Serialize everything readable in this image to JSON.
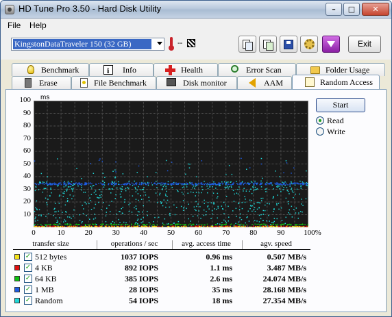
{
  "window": {
    "title": "HD Tune Pro 3.50 - Hard Disk Utility",
    "min": "–",
    "max": "□",
    "close": "✕"
  },
  "menu": {
    "file": "File",
    "help": "Help"
  },
  "toolbar": {
    "drive": "KingstonDataTraveler 150 (32 GB)",
    "temperature": "--",
    "exit": "Exit"
  },
  "tabs_row1": [
    "Benchmark",
    "Info",
    "Health",
    "Error Scan",
    "Folder Usage"
  ],
  "tabs_row2": [
    "Erase",
    "File Benchmark",
    "Disk monitor",
    "AAM",
    "Random Access"
  ],
  "controls": {
    "start": "Start",
    "read": "Read",
    "write": "Write",
    "selected": "Read"
  },
  "table": {
    "headers": [
      "transfer size",
      "operations / sec",
      "avg. access time",
      "agv. speed"
    ],
    "rows": [
      {
        "size": "512 bytes",
        "ops": "1037 IOPS",
        "access": "0.96 ms",
        "speed": "0.507 MB/s",
        "color": "#f5e31a",
        "checked": true
      },
      {
        "size": "4 KB",
        "ops": "892 IOPS",
        "access": "1.1 ms",
        "speed": "3.487 MB/s",
        "color": "#e01010",
        "checked": true
      },
      {
        "size": "64 KB",
        "ops": "385 IOPS",
        "access": "2.6 ms",
        "speed": "24.074 MB/s",
        "color": "#10c010",
        "checked": true
      },
      {
        "size": "1 MB",
        "ops": "28 IOPS",
        "access": "35 ms",
        "speed": "28.168 MB/s",
        "color": "#1e5be0",
        "checked": true
      },
      {
        "size": "Random",
        "ops": "54 IOPS",
        "access": "18 ms",
        "speed": "27.354 MB/s",
        "color": "#20d6d6",
        "checked": true
      }
    ]
  },
  "chart_data": {
    "type": "scatter",
    "ylabel": "ms",
    "ylim": [
      0,
      100
    ],
    "y_ticks": [
      "100",
      "90",
      "80",
      "70",
      "60",
      "50",
      "40",
      "30",
      "20",
      "10"
    ],
    "xlim": [
      0,
      100
    ],
    "x_ticks": [
      "0",
      "10",
      "20",
      "30",
      "40",
      "50",
      "60",
      "70",
      "80",
      "90",
      "100%"
    ],
    "grid": true,
    "series": [
      {
        "name": "512 bytes",
        "color": "#f5e31a",
        "access_ms": 0.96
      },
      {
        "name": "4 KB",
        "color": "#e01010",
        "access_ms": 1.1
      },
      {
        "name": "64 KB",
        "color": "#10c010",
        "access_ms": 2.6
      },
      {
        "name": "1 MB",
        "color": "#1e5be0",
        "access_ms": 35
      },
      {
        "name": "Random",
        "color": "#20d6d6",
        "access_ms": 18
      }
    ]
  }
}
